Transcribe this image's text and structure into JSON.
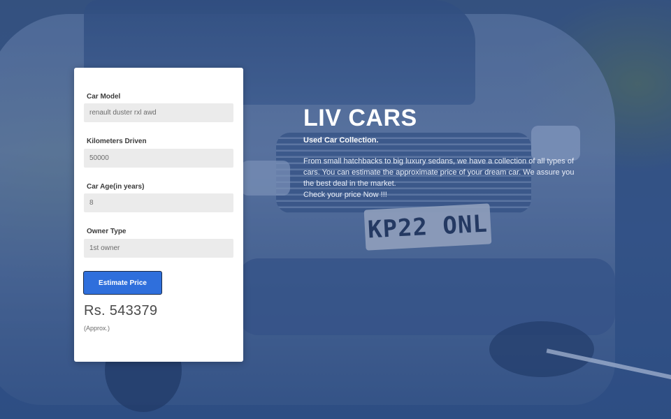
{
  "form": {
    "fields": [
      {
        "label": "Car Model",
        "value": "renault duster rxl awd"
      },
      {
        "label": "Kilometers Driven",
        "value": "50000"
      },
      {
        "label": "Car Age(in years)",
        "value": "8"
      },
      {
        "label": "Owner Type",
        "value": "1st owner"
      }
    ],
    "button_label": "Estimate Price",
    "result_price": "Rs. 543379",
    "result_note": "(Approx.)"
  },
  "hero": {
    "title": "LIV CARS",
    "subtitle": "Used Car Collection.",
    "description_lines": [
      "From small hatchbacks to big luxury sedans, we have a collection of all types of",
      "cars. You can estimate the approximate price of your dream car. We assure you",
      "the best deal in the market.",
      "Check your price Now !!!"
    ]
  },
  "background": {
    "license_plate": "KP22 ONL"
  },
  "colors": {
    "accent_button": "#2f6fdc",
    "overlay_blue": "#2f4d7f",
    "card_bg": "#ffffff",
    "input_bg": "#ebebeb"
  }
}
